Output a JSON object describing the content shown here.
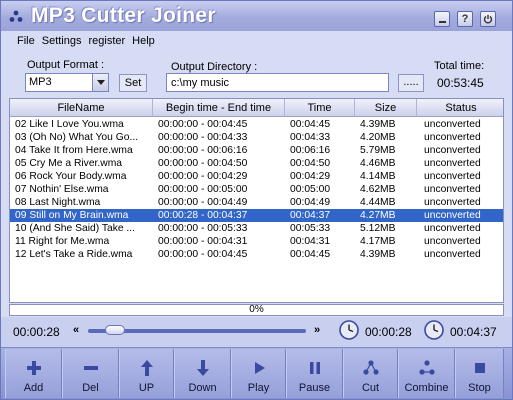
{
  "app": {
    "title": "MP3 Cutter Joiner"
  },
  "menu": [
    "File",
    "Settings",
    "register",
    "Help"
  ],
  "form": {
    "output_format_label": "Output Format :",
    "output_format_value": "MP3",
    "set_label": "Set",
    "output_dir_label": "Output Directory :",
    "output_dir_value": "c:\\my music",
    "browse_label": ".....",
    "total_time_label": "Total time:",
    "total_time_value": "00:53:45"
  },
  "table": {
    "columns": [
      "FileName",
      "Begin time - End time",
      "Time",
      "Size",
      "Status"
    ],
    "rows": [
      [
        "02 Like I Love You.wma",
        "00:00:00 - 00:04:45",
        "00:04:45",
        "4.39MB",
        "unconverted"
      ],
      [
        "03 (Oh No) What You Go...",
        "00:00:00 - 00:04:33",
        "00:04:33",
        "4.20MB",
        "unconverted"
      ],
      [
        "04 Take It from Here.wma",
        "00:00:00 - 00:06:16",
        "00:06:16",
        "5.79MB",
        "unconverted"
      ],
      [
        "05 Cry Me a River.wma",
        "00:00:00 - 00:04:50",
        "00:04:50",
        "4.46MB",
        "unconverted"
      ],
      [
        "06 Rock Your Body.wma",
        "00:00:00 - 00:04:29",
        "00:04:29",
        "4.14MB",
        "unconverted"
      ],
      [
        "07 Nothin' Else.wma",
        "00:00:00 - 00:05:00",
        "00:05:00",
        "4.62MB",
        "unconverted"
      ],
      [
        "08 Last Night.wma",
        "00:00:00 - 00:04:49",
        "00:04:49",
        "4.44MB",
        "unconverted"
      ],
      [
        "09 Still on My Brain.wma",
        "00:00:28 - 00:04:37",
        "00:04:37",
        "4.27MB",
        "unconverted"
      ],
      [
        "10 (And She Said) Take ...",
        "00:00:00 - 00:05:33",
        "00:05:33",
        "5.12MB",
        "unconverted"
      ],
      [
        "11 Right for Me.wma",
        "00:00:00 - 00:04:31",
        "00:04:31",
        "4.17MB",
        "unconverted"
      ],
      [
        "12 Let's Take a Ride.wma",
        "00:00:00 - 00:04:45",
        "00:04:45",
        "4.39MB",
        "unconverted"
      ]
    ],
    "selected_index": 7
  },
  "progress": {
    "value_fraction": 0,
    "text": "0%"
  },
  "player": {
    "current_time": "00:00:28",
    "seek_position_fraction": 0.09,
    "prev_symbol": "«",
    "next_symbol": "»",
    "start_time": "00:00:28",
    "end_time": "00:04:37"
  },
  "toolbar": [
    {
      "id": "add",
      "label": "Add",
      "icon": "plus-icon"
    },
    {
      "id": "del",
      "label": "Del",
      "icon": "minus-icon"
    },
    {
      "id": "up",
      "label": "UP",
      "icon": "arrow-up-icon"
    },
    {
      "id": "down",
      "label": "Down",
      "icon": "arrow-down-icon"
    },
    {
      "id": "play",
      "label": "Play",
      "icon": "play-icon"
    },
    {
      "id": "pause",
      "label": "Pause",
      "icon": "pause-icon"
    },
    {
      "id": "cut",
      "label": "Cut",
      "icon": "cut-icon"
    },
    {
      "id": "combine",
      "label": "Combine",
      "icon": "combine-icon"
    },
    {
      "id": "stop",
      "label": "Stop",
      "icon": "stop-icon"
    }
  ],
  "colors": {
    "selected_row": "#3165c8",
    "icon_fill": "#3a4aa0"
  }
}
